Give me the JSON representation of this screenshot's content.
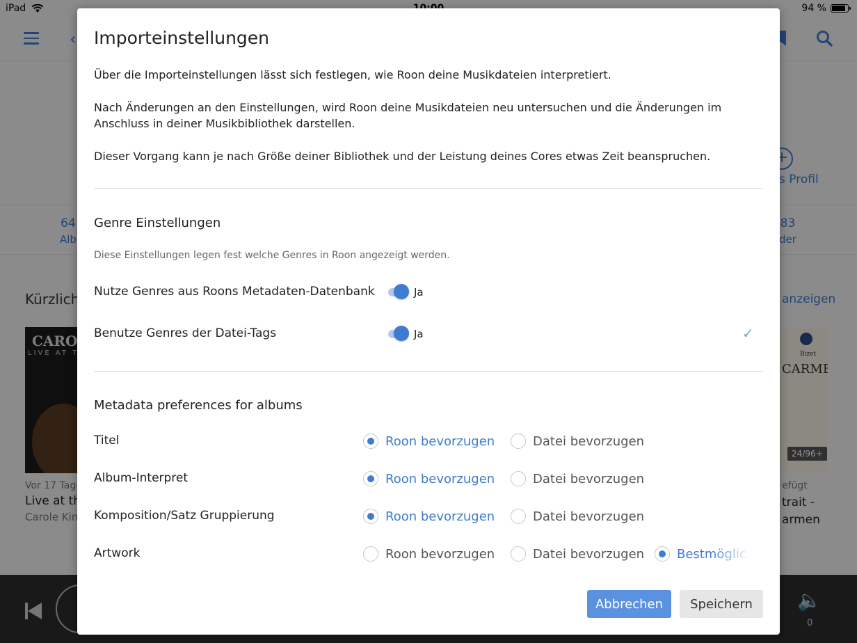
{
  "status_bar": {
    "device": "iPad",
    "time": "10:00",
    "battery": "94 %"
  },
  "background": {
    "profile_label": "s Profil",
    "stats": [
      {
        "num": "64",
        "label": "Alb"
      },
      {
        "num": "83",
        "label": "der"
      }
    ],
    "section_title": "Kürzlich",
    "show_all": "anzeigen",
    "albums": [
      {
        "added": "Vor 17 Tage",
        "title": "Live at th",
        "artist": "Carole Kin",
        "cover_title": "CAROLE K",
        "cover_sub": "LIVE AT T"
      },
      {
        "added": "efügt",
        "title_line1": "trait -",
        "title_line2": "armen",
        "cover_composer": "Bizet",
        "cover_name": "CARMEN",
        "badge": "24/96+"
      }
    ],
    "volume": "0"
  },
  "dialog": {
    "title": "Importeinstellungen",
    "intro": [
      "Über die Importeinstellungen lässt sich festlegen, wie Roon deine Musikdateien interpretiert.",
      "Nach Änderungen an den Einstellungen, wird Roon deine Musikdateien neu untersuchen und die Änderungen im Anschluss in deiner Musikbibliothek darstellen.",
      "Dieser Vorgang kann je nach Größe deiner Bibliothek und der Leistung deines Cores etwas Zeit beanspruchen."
    ],
    "genre": {
      "title": "Genre Einstellungen",
      "description": "Diese Einstellungen legen fest welche Genres in Roon angezeigt werden.",
      "rows": [
        {
          "label": "Nutze Genres aus Roons Metadaten-Datenbank",
          "value": "Ja",
          "checked": false
        },
        {
          "label": "Benutze Genres der Datei-Tags",
          "value": "Ja",
          "checked": true
        }
      ],
      "checkmark": "✓"
    },
    "metadata": {
      "title": "Metadata preferences for albums",
      "rows": [
        {
          "label": "Titel",
          "options": [
            "Roon bevorzugen",
            "Datei bevorzugen"
          ],
          "selected": 0
        },
        {
          "label": "Album-Interpret",
          "options": [
            "Roon bevorzugen",
            "Datei bevorzugen"
          ],
          "selected": 0
        },
        {
          "label": "Komposition/Satz Gruppierung",
          "options": [
            "Roon bevorzugen",
            "Datei bevorzugen"
          ],
          "selected": 0
        },
        {
          "label": "Artwork",
          "options": [
            "Roon bevorzugen",
            "Datei bevorzugen",
            "Bestmöglic"
          ],
          "selected": 2
        }
      ]
    },
    "buttons": {
      "cancel": "Abbrechen",
      "save": "Speichern"
    }
  },
  "colors": {
    "accent": "#3f7bd0",
    "primary_button": "#5b92e0",
    "secondary_button": "#e6e6e6"
  }
}
